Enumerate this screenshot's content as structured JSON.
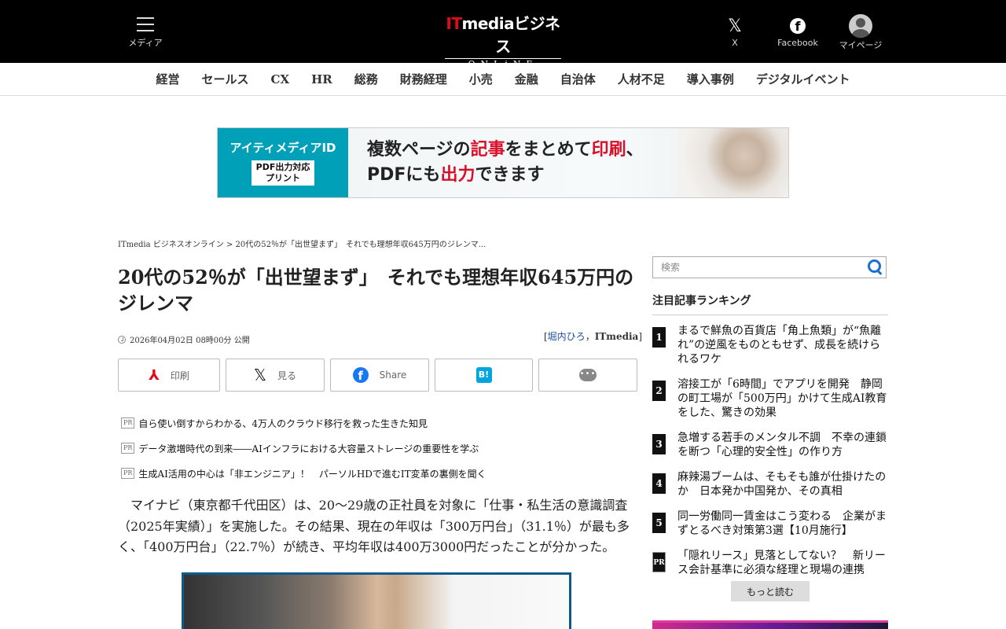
{
  "header": {
    "menu_label": "メディア",
    "logo_main": "ITmediaビジネス",
    "logo_it": "IT",
    "logo_rest": "mediaビジネス",
    "logo_sub": "ONLiNE",
    "x_label": "X",
    "facebook_label": "Facebook",
    "mypage_label": "マイページ"
  },
  "nav": [
    "経営",
    "セールス",
    "CX",
    "HR",
    "総務",
    "財務経理",
    "小売",
    "金融",
    "自治体",
    "人材不足",
    "導入事例",
    "デジタルイベント"
  ],
  "banner": {
    "brand": "アイティメディアID",
    "badge_line1": "PDF出力対応",
    "badge_line2": "プリント",
    "line1_a": "複数ページの",
    "line1_b": "記事",
    "line1_c": "をまとめて",
    "line1_d": "印刷",
    "line1_e": "、",
    "line2_a": "PDF",
    "line2_b": "にも",
    "line2_c": "出力",
    "line2_d": "できます"
  },
  "breadcrumb": "ITmedia ビジネスオンライン > 20代の52％が「出世望まず」　それでも理想年収645万円のジレンマ...",
  "article": {
    "title": "20代の52％が「出世望まず」　それでも理想年収645万円のジレンマ",
    "date": "2026年04月02日 08時00分 公開",
    "byline_open": "[",
    "author": "堀内ひろ",
    "byline_sep": "，",
    "publisher": "ITmedia",
    "byline_close": "]",
    "share": {
      "print": "印刷",
      "x": "見る",
      "facebook": "Share"
    },
    "pr_items": [
      "自ら使い倒すからわかる、4万人のクラウド移行を救った生きた知見",
      "データ激増時代の到来――AIインフラにおける大容量ストレージの重要性を学ぶ",
      "生成AI活用の中心は「非エンジニア」！　パーソルHDで進むIT変革の裏側を聞く"
    ],
    "pr_badge": "PR",
    "body": "　マイナビ（東京都千代田区）は、20～29歳の正社員を対象に「仕事・私生活の意識調査（2025年実績）」を実施した。その結果、現在の年収は「300万円台」（31.1％）が最も多く、「400万円台」（22.7％）が続き、平均年収は400万3000円だったことが分かった。"
  },
  "sidebar": {
    "search_placeholder": "検索",
    "ranking_title": "注目記事ランキング",
    "ranking": [
      {
        "rank": "1",
        "title": "まるで鮮魚の百貨店「角上魚類」が“魚離れ”の逆風をものともせず、成長を続けられるワケ"
      },
      {
        "rank": "2",
        "title": "溶接工が「6時間」でアプリを開発　静岡の町工場が「500万円」かけて生成AI教育をした、驚きの効果"
      },
      {
        "rank": "3",
        "title": "急増する若手のメンタル不調　不幸の連鎖を断つ「心理的安全性」の作り方"
      },
      {
        "rank": "4",
        "title": "麻辣湯ブームは、そもそも誰が仕掛けたのか　日本発か中国発か、その真相"
      },
      {
        "rank": "5",
        "title": "同一労働同一賃金はこう変わる　企業がまずとるべき対策第3選【10月施行】"
      },
      {
        "rank": "PR",
        "title": "「隠れリース」見落としてない？　新リース会計基準に必須な経理と現場の連携"
      }
    ],
    "more_label": "もっと読む"
  }
}
